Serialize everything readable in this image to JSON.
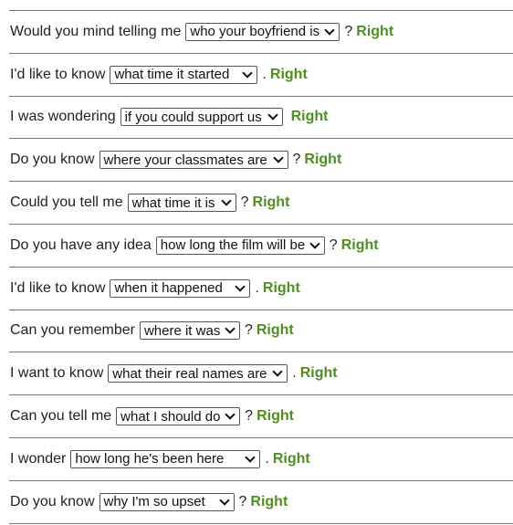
{
  "accent_color": "#4e8f1e",
  "rows": [
    {
      "prompt": "Would you mind telling me",
      "answer": "who your boyfriend is",
      "punct": "?",
      "result": "Right"
    },
    {
      "prompt": "I'd like to know",
      "answer": "what time it started",
      "punct": ".",
      "result": "Right"
    },
    {
      "prompt": "I was wondering",
      "answer": "if you could support us",
      "punct": "",
      "result": "Right"
    },
    {
      "prompt": "Do you know",
      "answer": "where your classmates are",
      "punct": "?",
      "result": "Right"
    },
    {
      "prompt": "Could you tell me",
      "answer": "what time it is",
      "punct": "?",
      "result": "Right"
    },
    {
      "prompt": "Do you have any idea",
      "answer": "how long the film will be",
      "punct": "?",
      "result": "Right"
    },
    {
      "prompt": "I'd like to know",
      "answer": "when it happened",
      "punct": ".",
      "result": "Right"
    },
    {
      "prompt": "Can you remember",
      "answer": "where it was",
      "punct": "?",
      "result": "Right"
    },
    {
      "prompt": "I want to know",
      "answer": "what their real names are",
      "punct": ".",
      "result": "Right"
    },
    {
      "prompt": "Can you tell me",
      "answer": "what I should do",
      "punct": "?",
      "result": "Right"
    },
    {
      "prompt": "I wonder",
      "answer": "how long he's been here",
      "punct": ".",
      "result": "Right"
    },
    {
      "prompt": "Do you know",
      "answer": "why I'm so upset",
      "punct": "?",
      "result": "Right"
    }
  ]
}
